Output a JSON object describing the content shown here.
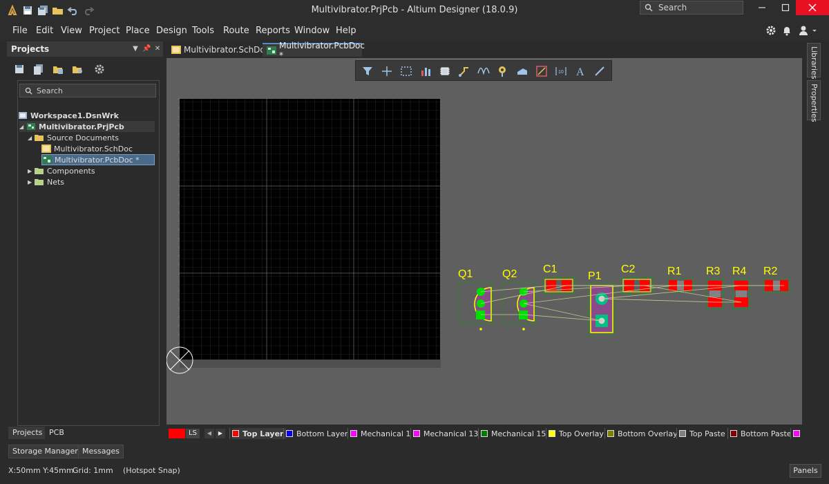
{
  "window": {
    "title": "Multivibrator.PrjPcb - Altium Designer (18.0.9)",
    "search_placeholder": "Search"
  },
  "menu": [
    "File",
    "Edit",
    "View",
    "Project",
    "Place",
    "Design",
    "Tools",
    "Route",
    "Reports",
    "Window",
    "Help"
  ],
  "projects_panel": {
    "title": "Projects",
    "search_placeholder": "Search",
    "tree": [
      {
        "label": "Workspace1.DsnWrk",
        "level": 0,
        "bold": true
      },
      {
        "label": "Multivibrator.PrjPcb",
        "level": 1,
        "bold": true,
        "expanded": true
      },
      {
        "label": "Source Documents",
        "level": 2,
        "expanded": true
      },
      {
        "label": "Multivibrator.SchDoc",
        "level": 3
      },
      {
        "label": "Multivibrator.PcbDoc *",
        "level": 3,
        "selected": true
      },
      {
        "label": "Components",
        "level": 2,
        "expanded": false
      },
      {
        "label": "Nets",
        "level": 2,
        "expanded": false
      }
    ],
    "tabs": [
      "Projects",
      "PCB"
    ]
  },
  "document_tabs": [
    {
      "label": "Multivibrator.SchDoc",
      "active": false
    },
    {
      "label": "Multivibrator.PcbDoc *",
      "active": true
    }
  ],
  "right_panels": [
    "Libraries",
    "Properties"
  ],
  "pcb": {
    "components": [
      "Q1",
      "Q2",
      "C1",
      "P1",
      "C2",
      "R1",
      "R3",
      "R4",
      "R2"
    ]
  },
  "layers": {
    "current_indicator": "LS",
    "items": [
      {
        "label": "Top Layer",
        "color": "#ff0000",
        "active": true
      },
      {
        "label": "Bottom Layer",
        "color": "#0000ff"
      },
      {
        "label": "Mechanical 1",
        "color": "#ff00ff"
      },
      {
        "label": "Mechanical 13",
        "color": "#ff00ff"
      },
      {
        "label": "Mechanical 15",
        "color": "#008000"
      },
      {
        "label": "Top Overlay",
        "color": "#ffff00"
      },
      {
        "label": "Bottom Overlay",
        "color": "#808000"
      },
      {
        "label": "Top Paste",
        "color": "#808080"
      },
      {
        "label": "Bottom Paste",
        "color": "#800000"
      }
    ]
  },
  "buttons": {
    "storage_manager": "Storage Manager",
    "messages": "Messages",
    "panels": "Panels"
  },
  "status": {
    "coords": "X:50mm Y:45mm",
    "grid": "Grid: 1mm",
    "snap": "(Hotspot Snap)"
  }
}
